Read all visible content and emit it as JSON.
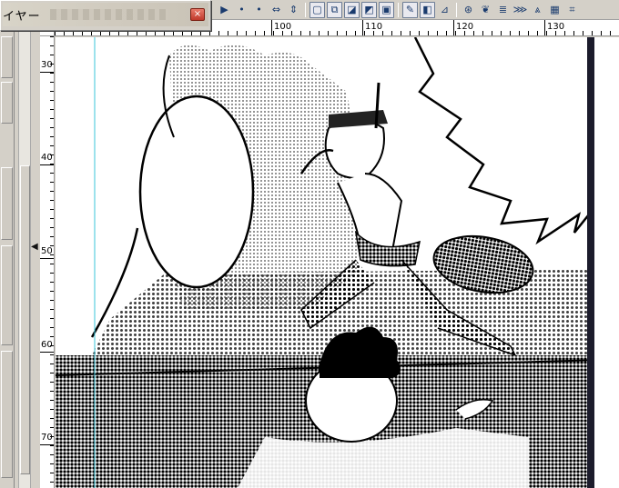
{
  "layer_palette": {
    "title": "イヤー",
    "close_glyph": "×"
  },
  "toolbar": {
    "buttons": [
      {
        "icon": "play-icon",
        "glyph": "▶"
      },
      {
        "icon": "dot-small-icon",
        "glyph": "•"
      },
      {
        "icon": "dot-icon",
        "glyph": "•"
      },
      {
        "icon": "horizontal-resize-icon",
        "glyph": "⇔"
      },
      {
        "icon": "vertical-resize-icon",
        "glyph": "⇕"
      },
      {
        "icon": "select-rect-icon",
        "glyph": "▢"
      },
      {
        "icon": "transform-icon",
        "glyph": "⧉"
      },
      {
        "icon": "crop-icon",
        "glyph": "◪"
      },
      {
        "icon": "selection-pen-icon",
        "glyph": "◩"
      },
      {
        "icon": "frame-icon",
        "glyph": "▣"
      },
      {
        "icon": "pen-icon",
        "glyph": "✎"
      },
      {
        "icon": "fill-icon",
        "glyph": "◧"
      },
      {
        "icon": "eyedropper-icon",
        "glyph": "⊿"
      },
      {
        "icon": "color-wheel-icon",
        "glyph": "⊛"
      },
      {
        "icon": "feather-icon",
        "glyph": "❦"
      },
      {
        "icon": "gradient-icon",
        "glyph": "≣"
      },
      {
        "icon": "speed-lines-icon",
        "glyph": "⋙"
      },
      {
        "icon": "perspective-icon",
        "glyph": "⩓"
      },
      {
        "icon": "tone-icon",
        "glyph": "▦"
      },
      {
        "icon": "grid-icon",
        "glyph": "⌗"
      }
    ]
  },
  "ruler_top": {
    "labels": [
      "100",
      "110",
      "120",
      "130"
    ]
  },
  "ruler_left": {
    "labels": [
      "30",
      "40",
      "50",
      "60",
      "70"
    ]
  },
  "panel_marker": "◀"
}
